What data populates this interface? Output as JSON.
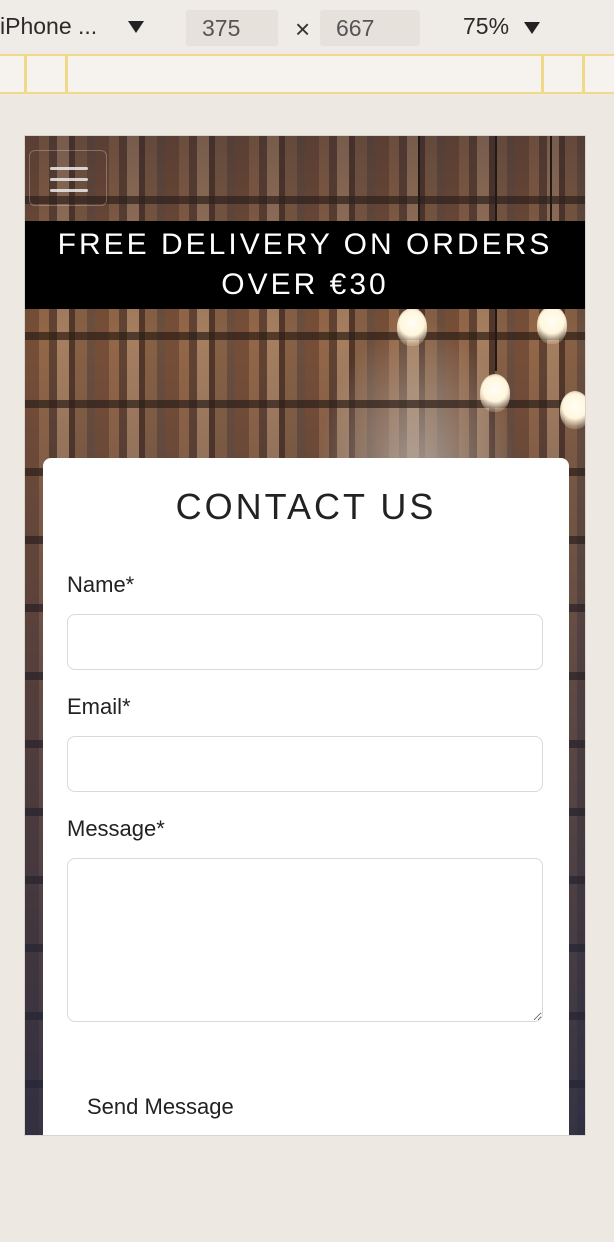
{
  "toolbar": {
    "device": "iPhone ...",
    "width": "375",
    "times": "×",
    "height": "667",
    "zoom": "75%"
  },
  "page": {
    "promo_line1": "FREE DELIVERY ON ORDERS",
    "promo_line2": "OVER €30",
    "form": {
      "title": "CONTACT US",
      "name_label": "Name*",
      "email_label": "Email*",
      "message_label": "Message*",
      "name_value": "",
      "email_value": "",
      "message_value": "",
      "submit_label": "Send Message"
    }
  },
  "icons": {
    "menu": "hamburger-icon",
    "dropdown": "caret-down-icon"
  }
}
